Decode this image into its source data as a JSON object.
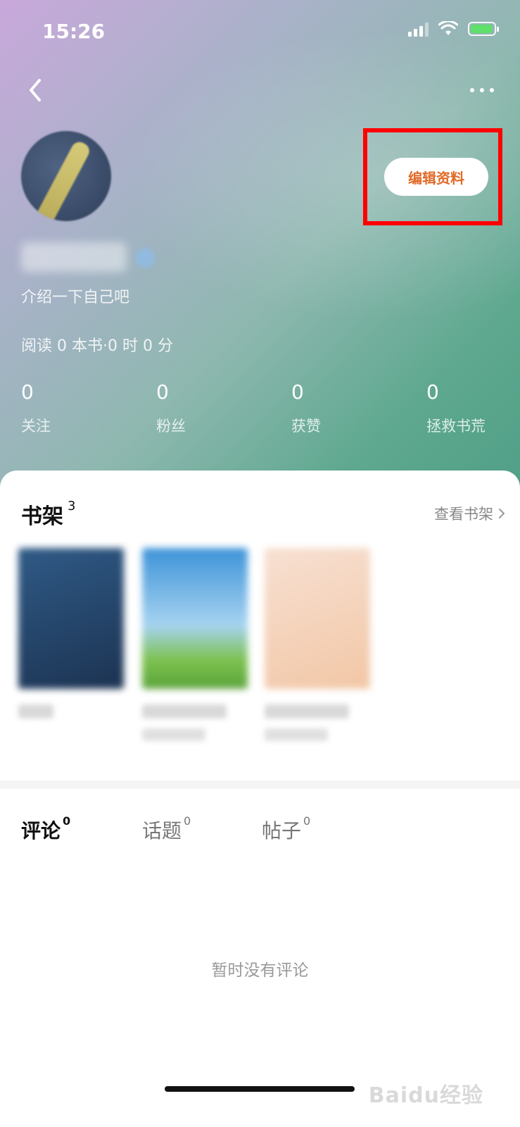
{
  "status_bar": {
    "time": "15:26"
  },
  "header": {
    "back_icon": "chevron-left-icon",
    "more_icon": "more-dots-icon"
  },
  "profile": {
    "edit_button_label": "编辑资料",
    "nickname": "",
    "bio": "介绍一下自己吧",
    "reading": {
      "prefix": "阅读",
      "books": "0",
      "books_unit": "本书",
      "sep": "·",
      "hours": "0",
      "hours_unit": "时",
      "minutes": "0",
      "minutes_unit": "分"
    }
  },
  "stats": [
    {
      "value": "0",
      "label": "关注"
    },
    {
      "value": "0",
      "label": "粉丝"
    },
    {
      "value": "0",
      "label": "获赞"
    },
    {
      "value": "0",
      "label": "拯救书荒"
    }
  ],
  "bookshelf": {
    "title": "书架",
    "count": "3",
    "view_link": "查看书架",
    "books": [
      {
        "cover_color": "#26476e"
      },
      {
        "cover_color": "#5fa9e0"
      },
      {
        "cover_color": "#f3cdb5"
      }
    ]
  },
  "tabs": [
    {
      "label": "评论",
      "count": "0",
      "active": true
    },
    {
      "label": "话题",
      "count": "0",
      "active": false
    },
    {
      "label": "帖子",
      "count": "0",
      "active": false
    }
  ],
  "empty_state": "暂时没有评论",
  "watermark": "Baidu经验",
  "colors": {
    "accent": "#e06a28",
    "highlight": "#ff0000"
  }
}
